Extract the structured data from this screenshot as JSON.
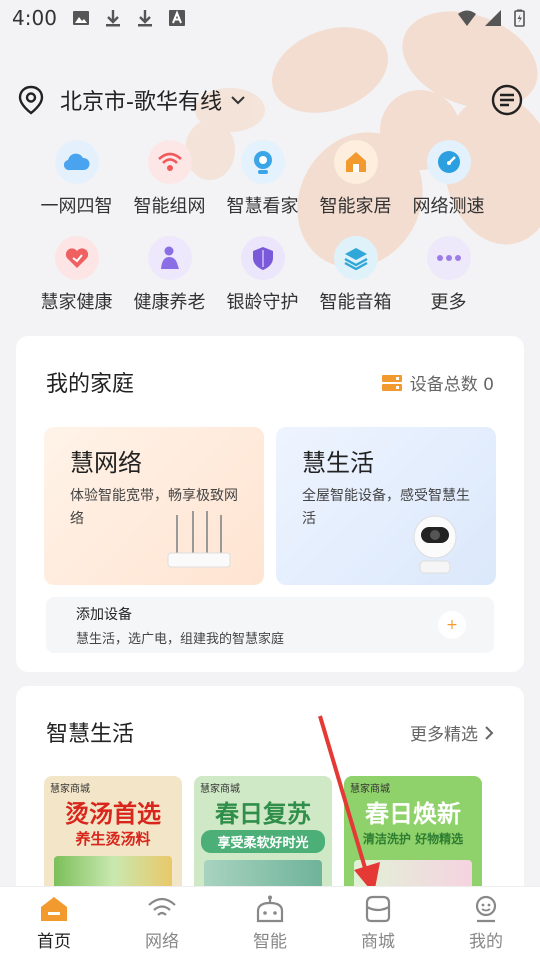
{
  "status_bar": {
    "time": "4:00"
  },
  "header": {
    "location": "北京市-歌华有线"
  },
  "grid_items": [
    {
      "label": "一网四智",
      "color": "#4aa3ee",
      "bg": "#e4f1fd"
    },
    {
      "label": "智能组网",
      "color": "#f05a5a",
      "bg": "#fde6e6"
    },
    {
      "label": "智慧看家",
      "color": "#3aa5e8",
      "bg": "#e3f2fc"
    },
    {
      "label": "智能家居",
      "color": "#f39a2f",
      "bg": "#fdeedd"
    },
    {
      "label": "网络测速",
      "color": "#2b9fe0",
      "bg": "#e2f1fb"
    },
    {
      "label": "慧家健康",
      "color": "#ef6060",
      "bg": "#fde5e5"
    },
    {
      "label": "健康养老",
      "color": "#8a6ee6",
      "bg": "#ede8fb"
    },
    {
      "label": "银龄守护",
      "color": "#7a5ad8",
      "bg": "#ebe6fb"
    },
    {
      "label": "智能音箱",
      "color": "#2fa7d8",
      "bg": "#e0f2f9"
    },
    {
      "label": "更多",
      "color": "#9c7ce8",
      "bg": "#eee8fb"
    }
  ],
  "family": {
    "title": "我的家庭",
    "device_total": "设备总数 0",
    "net_title": "慧网络",
    "net_desc": "体验智能宽带，畅享极致网络",
    "life_title": "慧生活",
    "life_desc": "全屋智能设备，感受智慧生活",
    "add_title": "添加设备",
    "add_desc": "慧生活，选广电，组建我的智慧家庭",
    "add_icon": "+"
  },
  "smart_life": {
    "title": "智慧生活",
    "more": "更多精选",
    "promos": [
      {
        "shop": "慧家商城",
        "big": "烫汤首选",
        "sub": "养生烫汤料",
        "bg": "#f3e6c8",
        "color": "#d8261c"
      },
      {
        "shop": "慧家商城",
        "big": "春日复苏",
        "sub": "享受柔软好时光",
        "bg": "#cfe8c6",
        "color": "#2f8f4a"
      },
      {
        "shop": "慧家商城",
        "big": "春日焕新",
        "sub": "清洁洗护 好物精选",
        "bg": "#8fd16a",
        "color": "#ffffff"
      }
    ]
  },
  "nav": [
    {
      "label": "首页",
      "active": true
    },
    {
      "label": "网络"
    },
    {
      "label": "智能"
    },
    {
      "label": "商城"
    },
    {
      "label": "我的"
    }
  ],
  "colors": {
    "accent": "#f39a2f",
    "annotation_arrow": "#e53935"
  }
}
